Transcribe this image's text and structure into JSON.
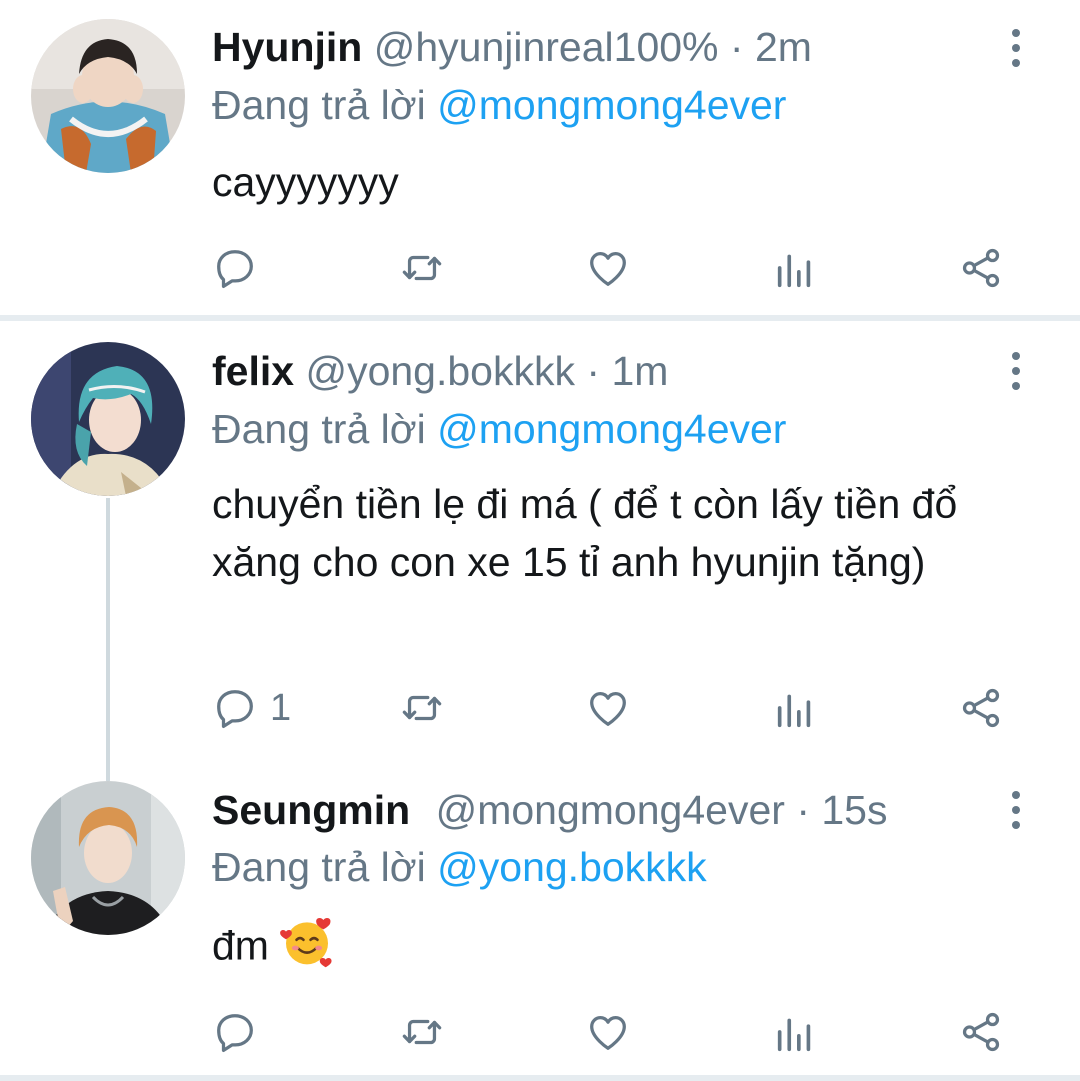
{
  "colors": {
    "accent": "#1da1f2",
    "secondary_text": "#657786",
    "primary_text": "#14171a",
    "divider": "#e6ecf0"
  },
  "reply_prefix": "Đang trả lời",
  "tweets": [
    {
      "name": "Hyunjin",
      "handle": "@hyunjinreal100%",
      "separator": "·",
      "time": "2m",
      "reply_to": "@mongmong4ever",
      "text": "cayyyyyyy",
      "reply_count": "",
      "avatar_icon": "avatar-photo"
    },
    {
      "name": "felix",
      "handle": "@yong.bokkkk",
      "separator": "·",
      "time": "1m",
      "reply_to": "@mongmong4ever",
      "text": "chuyển tiền lẹ đi má ( để t còn lấy tiền đổ xăng cho con xe 15 tỉ anh hyunjin tặng)",
      "reply_count": "1",
      "avatar_icon": "avatar-photo"
    },
    {
      "name": "Seungmin",
      "handle": "@mongmong4ever",
      "separator": "·",
      "time": "15s",
      "reply_to": "@yong.bokkkk",
      "text": "đm",
      "emoji": "smiling-face-with-hearts-emoji",
      "reply_count": "",
      "avatar_icon": "avatar-photo"
    }
  ],
  "actions": [
    "reply-icon",
    "retweet-icon",
    "like-icon",
    "analytics-icon",
    "share-icon"
  ]
}
